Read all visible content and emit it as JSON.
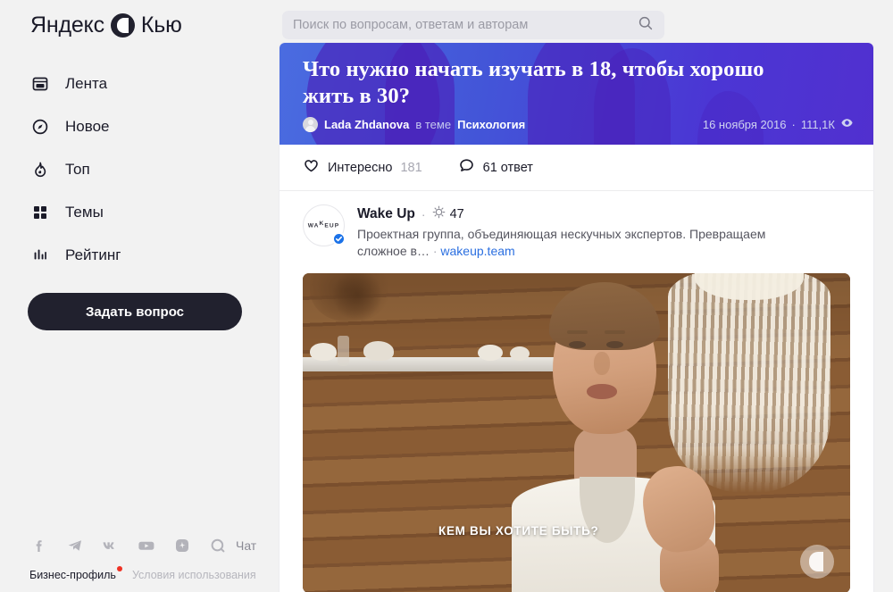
{
  "brand": {
    "name": "Яндекс",
    "product": "Кью",
    "logo_icon": "yandex-q-logo-icon"
  },
  "search": {
    "placeholder": "Поиск по вопросам, ответам и авторам",
    "value": "",
    "icon": "search-icon"
  },
  "sidebar": {
    "items": [
      {
        "label": "Лента",
        "icon": "feed-icon"
      },
      {
        "label": "Новое",
        "icon": "compass-icon"
      },
      {
        "label": "Топ",
        "icon": "flame-icon"
      },
      {
        "label": "Темы",
        "icon": "grid-icon"
      },
      {
        "label": "Рейтинг",
        "icon": "bar-chart-icon"
      }
    ],
    "ask_button": "Задать вопрос"
  },
  "footer": {
    "social": [
      {
        "name": "facebook-icon"
      },
      {
        "name": "telegram-icon"
      },
      {
        "name": "vk-icon"
      },
      {
        "name": "youtube-icon"
      },
      {
        "name": "zen-icon"
      },
      {
        "name": "chat-q-icon"
      }
    ],
    "chat_label": "Чат",
    "business_profile": "Бизнес-профиль",
    "terms": "Условия использования"
  },
  "question": {
    "title": "Что нужно начать изучать в 18, чтобы хорошо жить в 30?",
    "author": "Lada Zhdanova",
    "in_topic_prefix": "в теме",
    "topic": "Психология",
    "date": "16 ноября 2016",
    "views": "111,1К",
    "views_icon": "eye-icon",
    "separator": "·"
  },
  "actions": {
    "interesting_label": "Интересно",
    "interesting_count": "181",
    "interesting_icon": "heart-icon",
    "answers_label": "61 ответ",
    "answers_icon": "comment-icon"
  },
  "answer_author": {
    "name": "Wake Up",
    "avatar_text": "WAKEUP",
    "avatar_text_parts": {
      "before": "WA",
      "raised": "K",
      "after": "EUP"
    },
    "verified_icon": "verified-badge-icon",
    "rating_icon": "rating-burst-icon",
    "rating": "47",
    "separator": "·",
    "bio": "Проектная группа, объединяющая нескучных экспертов. Превращаем сложное в…",
    "link": "wakeup.team"
  },
  "video": {
    "subtitle": "КЕМ ВЫ ХОТИТЕ БЫТЬ?",
    "watermark_icon": "q-watermark-icon"
  },
  "colors": {
    "page_bg": "#f2f2f2",
    "card_bg": "#ffffff",
    "banner_from": "#4a6ce0",
    "banner_to": "#5130cf",
    "accent_dark": "#21212e",
    "link_blue": "#2b6fe0",
    "verified_blue": "#1b72e8",
    "muted": "#a8a8b2",
    "red_dot": "#ef3124"
  }
}
